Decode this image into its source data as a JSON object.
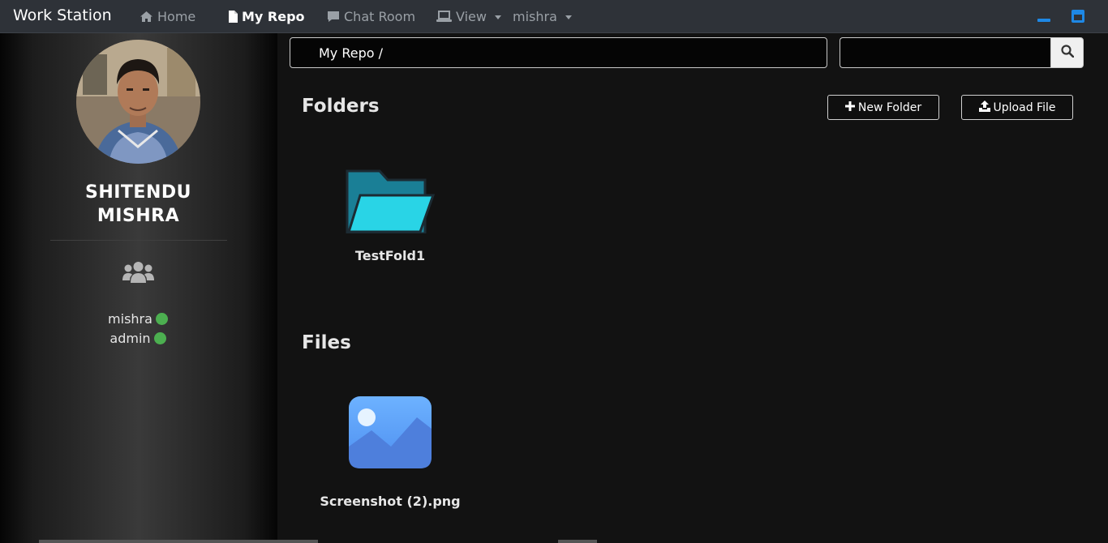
{
  "navbar": {
    "brand": "Work Station",
    "items": [
      {
        "label": "Home",
        "icon": "home-icon"
      },
      {
        "label": "My Repo",
        "icon": "file-icon",
        "active": true
      },
      {
        "label": "Chat Room",
        "icon": "chat-icon"
      },
      {
        "label": "View",
        "icon": "laptop-icon",
        "dropdown": true
      },
      {
        "label": "mishra",
        "dropdown": true
      }
    ],
    "window_controls": [
      "minimize-icon",
      "maximize-icon"
    ]
  },
  "sidebar": {
    "user_name_line1": "SHITENDU",
    "user_name_line2": "MISHRA",
    "online_users": [
      {
        "name": "mishra",
        "status": "online"
      },
      {
        "name": "admin",
        "status": "online"
      }
    ]
  },
  "breadcrumb": "My Repo /",
  "search": {
    "value": "",
    "placeholder": ""
  },
  "folders_section": {
    "title": "Folders",
    "new_folder_label": "New Folder",
    "upload_file_label": "Upload File",
    "items": [
      {
        "name": "TestFold1"
      }
    ]
  },
  "files_section": {
    "title": "Files",
    "items": [
      {
        "name": "Screenshot (2).png"
      }
    ]
  },
  "colors": {
    "navbar_bg": "#2e3238",
    "content_bg": "#121212",
    "online_dot": "#4caf50",
    "folder_dark": "#1a7f96",
    "folder_light": "#29d4e6",
    "image_icon": "#5b9cf5",
    "window_control": "#1e88e5"
  }
}
